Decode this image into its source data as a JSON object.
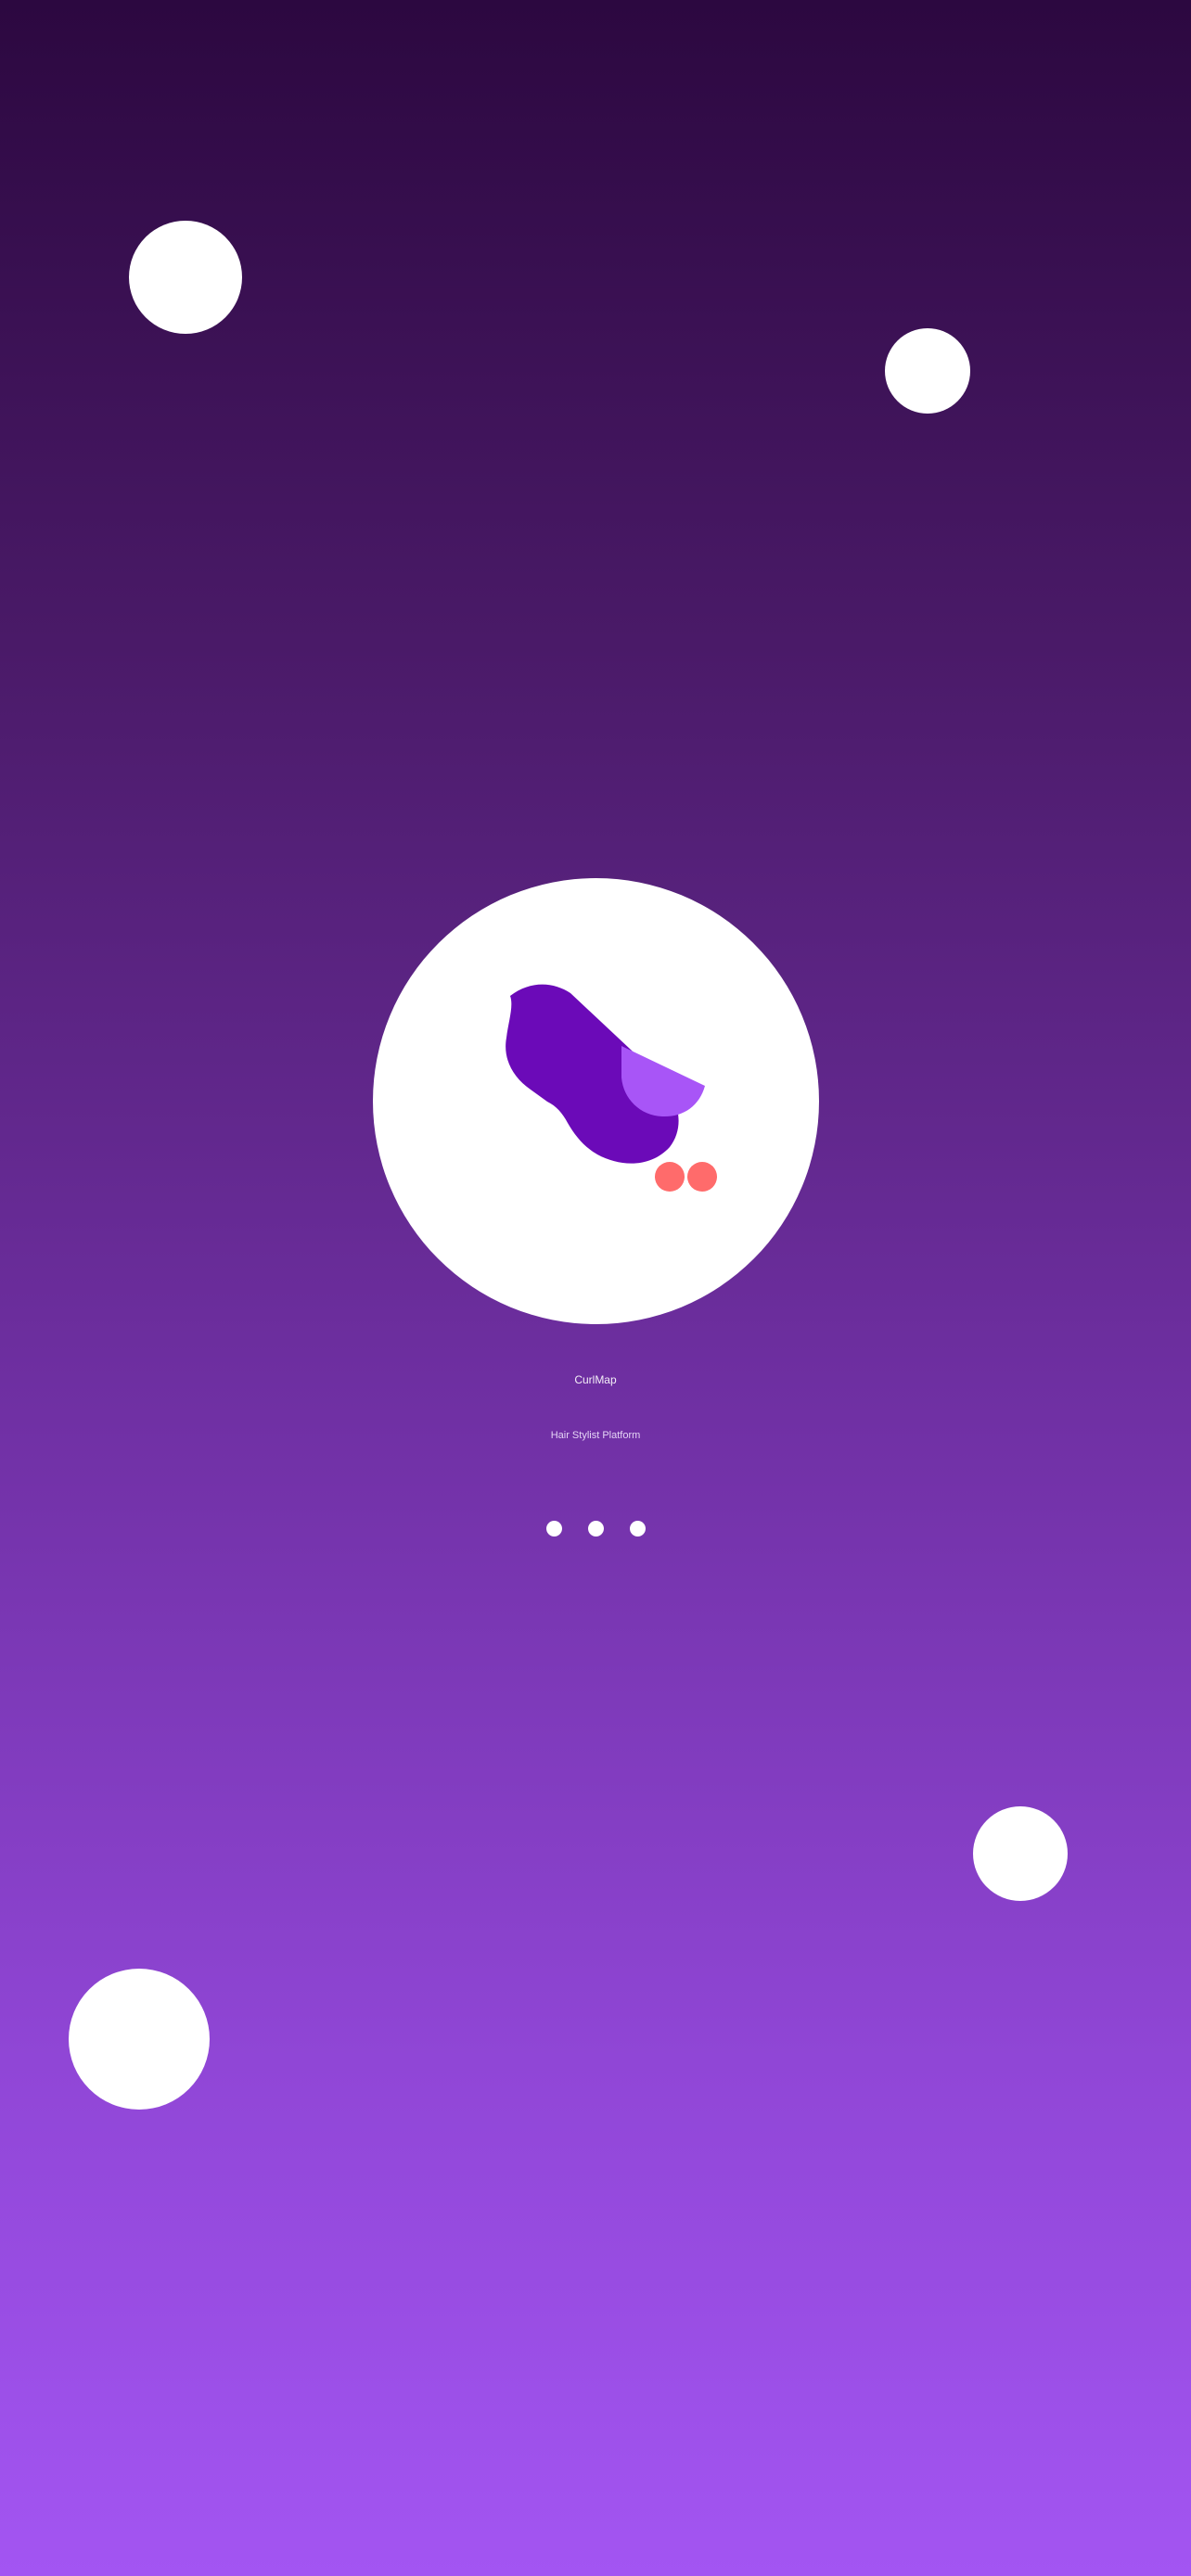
{
  "app": {
    "title": "CurlMap",
    "subtitle": "Hair Stylist Platform"
  },
  "loading": {
    "dot_count": 3,
    "icon": "loading-dots"
  },
  "logo": {
    "icon": "hair-curl-logo",
    "colors": {
      "primary": "#6b0ab8",
      "accent": "#a855f7",
      "highlight": "#ff6b6b"
    }
  },
  "theme": {
    "background_top": "#2c0840",
    "background_bottom": "#a355f2",
    "bubble": "#ffffff"
  }
}
